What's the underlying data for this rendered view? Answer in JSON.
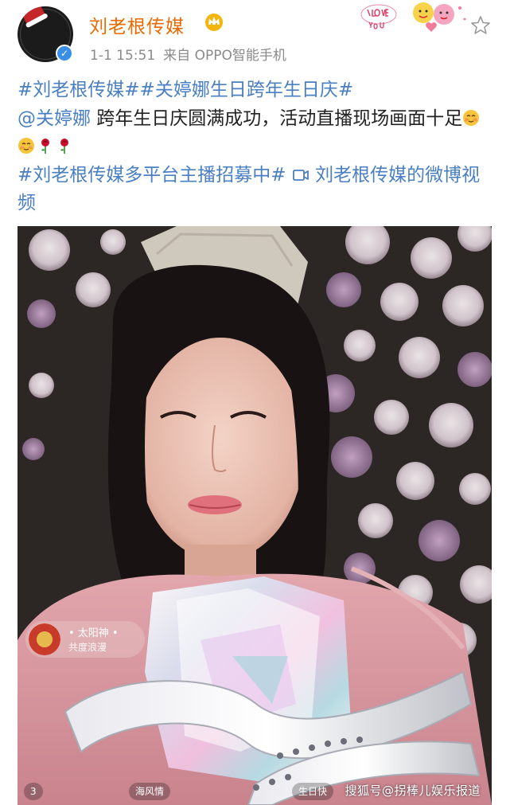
{
  "header": {
    "username": "刘老根传媒",
    "time": "1-1 15:51",
    "source": "来自 OPPO智能手机",
    "avatar_icon": "avatar-logo",
    "verified_icon": "verified-badge-icon",
    "crown_icon": "crown-badge-icon",
    "star_icon": "star-icon"
  },
  "post": {
    "tag1": "#刘老根传媒#",
    "tag2": "#关婷娜生日跨年生日庆#",
    "mention": "@关婷娜",
    "text1": " 跨年生日庆圆满成功，活动直播现场画面十足",
    "tag3": "#刘老根传媒多平台主播招募中#",
    "video_link": " 刘老根传媒的微博视频"
  },
  "video": {
    "badge_name": "• 太阳神 •",
    "badge_sub": "共度浪漫",
    "chip_left": "3",
    "chip_mid": "海风情",
    "chip_right": "生日快",
    "watermark": "搜狐号@拐棒儿娱乐报道"
  },
  "colors": {
    "username": "#e96a00",
    "link": "#4a7fc1",
    "meta": "#8a8a8a"
  }
}
